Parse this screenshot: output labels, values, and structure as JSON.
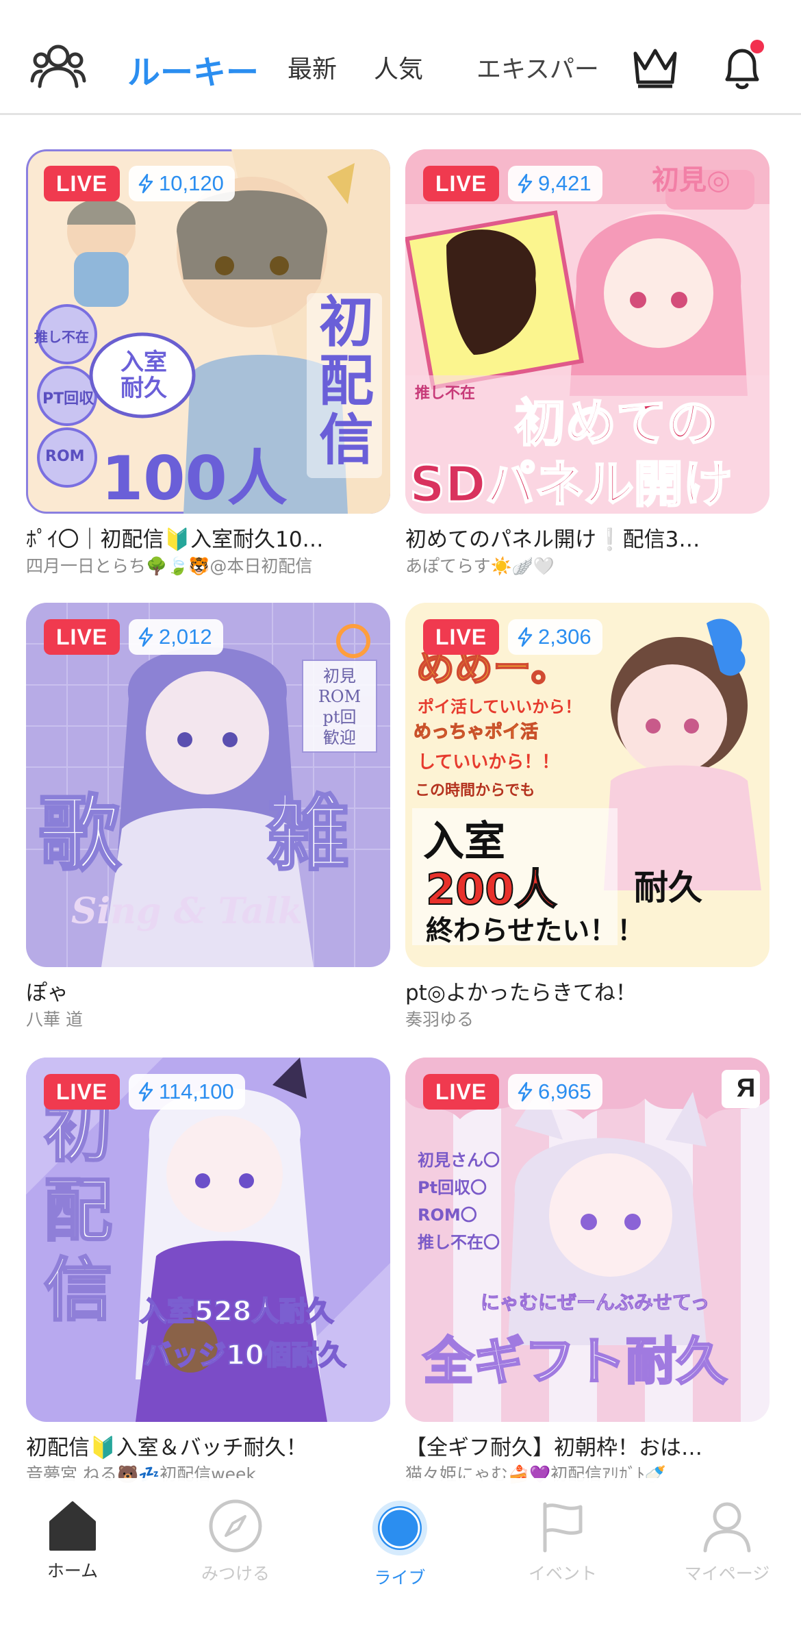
{
  "header": {
    "tabs": [
      {
        "label": "ルーキー",
        "active": true
      },
      {
        "label": "最新",
        "active": false
      },
      {
        "label": "人気",
        "active": false
      },
      {
        "label": "エキスパー",
        "active": false
      }
    ],
    "icons": [
      "people-icon",
      "crown-icon",
      "bell-icon"
    ],
    "has_notification": true
  },
  "cards": [
    {
      "live_label": "LIVE",
      "points": "10,120",
      "title": "ﾎﾟｲ〇｜初配信🔰入室耐久10…",
      "streamer": "四月一日とらち🌳🍃🐯@本日初配信",
      "art_text": [
        "初",
        "配",
        "信",
        "100人",
        "入室",
        "耐久",
        "推し不在",
        "PT回収",
        "ROM"
      ]
    },
    {
      "live_label": "LIVE",
      "points": "9,421",
      "title": "初めてのパネル開け❕配信3…",
      "streamer": "あぽてらす☀️🪽🤍",
      "art_text": [
        "初めての",
        "SDパネル開け",
        "初見◎",
        "推し不在"
      ]
    },
    {
      "live_label": "LIVE",
      "points": "2,012",
      "title": "ぽゃ",
      "streamer": "八華 道",
      "art_text": [
        "歌",
        "雑",
        "Sing & Talk",
        "初見",
        "ROM",
        "pt回",
        "歓迎"
      ]
    },
    {
      "live_label": "LIVE",
      "points": "2,306",
      "title": "pt◎よかったらきてね！",
      "streamer": "奏羽ゆる",
      "art_text": [
        "めめー。",
        "ポイ活していいから！",
        "めっちゃポイ活",
        "していいから！！",
        "この時間からでも",
        "入室",
        "200人",
        "耐久",
        "終わらせたい！！"
      ]
    },
    {
      "live_label": "LIVE",
      "points": "114,100",
      "title": "初配信🔰入室＆バッチ耐久！",
      "streamer": "音夢宮 ねる🐻💤初配信week",
      "art_text": [
        "初",
        "配",
        "信",
        "入室528人耐久",
        "バッジ10個耐久"
      ]
    },
    {
      "live_label": "LIVE",
      "points": "6,965",
      "title": "【全ギフ耐久】初朝枠！おは…",
      "streamer": "猫々姫にゃむ🍰💜初配信ｱﾘｶﾞﾄ🍼",
      "art_text": [
        "初見さん〇",
        "Pt回収〇",
        "ROM〇",
        "推し不在〇",
        "にゃむにぜーんぶみせてっ",
        "全ギフト耐久"
      ]
    }
  ],
  "bottom_nav": [
    {
      "label": "ホーム",
      "icon": "home-icon",
      "state": "active"
    },
    {
      "label": "みつける",
      "icon": "compass-icon",
      "state": "inactive"
    },
    {
      "label": "ライブ",
      "icon": "live-icon",
      "state": "active-live"
    },
    {
      "label": "イベント",
      "icon": "flag-icon",
      "state": "inactive"
    },
    {
      "label": "マイページ",
      "icon": "user-icon",
      "state": "inactive"
    }
  ],
  "colors": {
    "accent": "#2b8ef0",
    "live": "#f03a4f",
    "divider": "#e3e3e3",
    "nav_inactive": "#c8c8c8"
  }
}
